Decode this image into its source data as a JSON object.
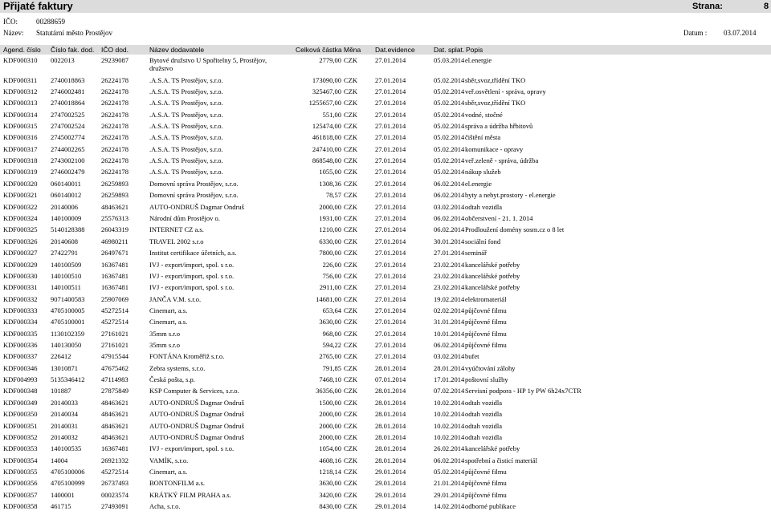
{
  "report": {
    "title": "Přijaté faktury",
    "page_label": "Strana:",
    "page_value": "8",
    "ico_label": "IČO:",
    "ico_value": "00288659",
    "name_label": "Název:",
    "name_value": "Statutární město Prostějov",
    "datum_label": "Datum :",
    "datum_value": "03.07.2014"
  },
  "columns": [
    "Agend. číslo",
    "Číslo fak. dod.",
    "IČO dod.",
    "Název dodavatele",
    "Celková částka",
    "Měna",
    "Dat.evidence",
    "Dat. splat.",
    "Popis"
  ],
  "rows": [
    {
      "a": "KDF000310",
      "b": "0022013",
      "c": "29239087",
      "d": "Bytové družstvo U Spořitelny 5, Prostějov,",
      "d2": "družstvo",
      "e": "2779,00",
      "f": "CZK",
      "g": "27.01.2014",
      "h": "05.03.2014",
      "i": "el.energie"
    },
    {
      "a": "KDF000311",
      "b": "2740018863",
      "c": "26224178",
      "d": ".A.S.A. TS Prostějov, s.r.o.",
      "e": "173090,00",
      "f": "CZK",
      "g": "27.01.2014",
      "h": "05.02.2014",
      "i": "sběr,svoz,třídění TKO"
    },
    {
      "a": "KDF000312",
      "b": "2746002481",
      "c": "26224178",
      "d": ".A.S.A. TS Prostějov, s.r.o.",
      "e": "325467,00",
      "f": "CZK",
      "g": "27.01.2014",
      "h": "05.02.2014",
      "i": "veř.osvětlení - správa, opravy"
    },
    {
      "a": "KDF000313",
      "b": "2740018864",
      "c": "26224178",
      "d": ".A.S.A. TS Prostějov, s.r.o.",
      "e": "1255657,00",
      "f": "CZK",
      "g": "27.01.2014",
      "h": "05.02.2014",
      "i": "sběr,svoz,třídění TKO"
    },
    {
      "a": "KDF000314",
      "b": "2747002525",
      "c": "26224178",
      "d": ".A.S.A. TS Prostějov, s.r.o.",
      "e": "551,00",
      "f": "CZK",
      "g": "27.01.2014",
      "h": "05.02.2014",
      "i": "vodné, stočné"
    },
    {
      "a": "KDF000315",
      "b": "2747002524",
      "c": "26224178",
      "d": ".A.S.A. TS Prostějov, s.r.o.",
      "e": "125474,00",
      "f": "CZK",
      "g": "27.01.2014",
      "h": "05.02.2014",
      "i": "správa a údržba hřbitovů"
    },
    {
      "a": "KDF000316",
      "b": "2745002774",
      "c": "26224178",
      "d": ".A.S.A. TS Prostějov, s.r.o.",
      "e": "461818,00",
      "f": "CZK",
      "g": "27.01.2014",
      "h": "05.02.2014",
      "i": "čištění města"
    },
    {
      "a": "KDF000317",
      "b": "2744002265",
      "c": "26224178",
      "d": ".A.S.A. TS Prostějov, s.r.o.",
      "e": "247410,00",
      "f": "CZK",
      "g": "27.01.2014",
      "h": "05.02.2014",
      "i": "komunikace - opravy"
    },
    {
      "a": "KDF000318",
      "b": "2743002100",
      "c": "26224178",
      "d": ".A.S.A. TS Prostějov, s.r.o.",
      "e": "868548,00",
      "f": "CZK",
      "g": "27.01.2014",
      "h": "05.02.2014",
      "i": "veř.zeleně - správa, údržba"
    },
    {
      "a": "KDF000319",
      "b": "2746002479",
      "c": "26224178",
      "d": ".A.S.A. TS Prostějov, s.r.o.",
      "e": "1055,00",
      "f": "CZK",
      "g": "27.01.2014",
      "h": "05.02.2014",
      "i": "nákup služeb"
    },
    {
      "a": "KDF000320",
      "b": "060140011",
      "c": "26259893",
      "d": "Domovní správa Prostějov, s.r.o.",
      "e": "1308,36",
      "f": "CZK",
      "g": "27.01.2014",
      "h": "06.02.2014",
      "i": "el.energie"
    },
    {
      "a": "KDF000321",
      "b": "060140012",
      "c": "26259893",
      "d": "Domovní správa Prostějov, s.r.o.",
      "e": "78,57",
      "f": "CZK",
      "g": "27.01.2014",
      "h": "06.02.2014",
      "i": "byty a nebyt.prostory - el.energie"
    },
    {
      "a": "KDF000322",
      "b": "20140006",
      "c": "48463621",
      "d": "AUTO-ONDRUŠ Dagmar Ondruš",
      "e": "2000,00",
      "f": "CZK",
      "g": "27.01.2014",
      "h": "03.02.2014",
      "i": "odtah vozidla"
    },
    {
      "a": "KDF000324",
      "b": "140100009",
      "c": "25576313",
      "d": "Národní dům Prostějov o.",
      "e": "1931,00",
      "f": "CZK",
      "g": "27.01.2014",
      "h": "06.02.2014",
      "i": "občerstvení - 21. 1. 2014"
    },
    {
      "a": "KDF000325",
      "b": "5140128388",
      "c": "26043319",
      "d": "INTERNET CZ a.s.",
      "e": "1210,00",
      "f": "CZK",
      "g": "27.01.2014",
      "h": "06.02.2014",
      "i": "Prodloužení domény sosm.cz o 8 let"
    },
    {
      "a": "KDF000326",
      "b": "20140608",
      "c": "46980211",
      "d": "TRAVEL 2002 s.r.o",
      "e": "6330,00",
      "f": "CZK",
      "g": "27.01.2014",
      "h": "30.01.2014",
      "i": "sociální fond"
    },
    {
      "a": "KDF000327",
      "b": "27422791",
      "c": "26497671",
      "d": "Institut certifikace účetních, a.s.",
      "e": "7800,00",
      "f": "CZK",
      "g": "27.01.2014",
      "h": "27.01.2014",
      "i": "seminář"
    },
    {
      "a": "KDF000329",
      "b": "140100509",
      "c": "16367481",
      "d": "IVJ - export/import, spol. s r.o.",
      "e": "226,00",
      "f": "CZK",
      "g": "27.01.2014",
      "h": "23.02.2014",
      "i": "kancelářské potřeby"
    },
    {
      "a": "KDF000330",
      "b": "140100510",
      "c": "16367481",
      "d": "IVJ - export/import, spol. s r.o.",
      "e": "756,00",
      "f": "CZK",
      "g": "27.01.2014",
      "h": "23.02.2014",
      "i": "kancelářské potřeby"
    },
    {
      "a": "KDF000331",
      "b": "140100511",
      "c": "16367481",
      "d": "IVJ - export/import, spol. s r.o.",
      "e": "2911,00",
      "f": "CZK",
      "g": "27.01.2014",
      "h": "23.02.2014",
      "i": "kancelářské potřeby"
    },
    {
      "a": "KDF000332",
      "b": "9071400583",
      "c": "25907069",
      "d": "JANČA V.M. s.r.o.",
      "e": "14681,00",
      "f": "CZK",
      "g": "27.01.2014",
      "h": "19.02.2014",
      "i": "elektromateriál"
    },
    {
      "a": "KDF000333",
      "b": "4705100005",
      "c": "45272514",
      "d": "Cinemart, a.s.",
      "e": "653,64",
      "f": "CZK",
      "g": "27.01.2014",
      "h": "02.02.2014",
      "i": "půjčovné filmu"
    },
    {
      "a": "KDF000334",
      "b": "4705100001",
      "c": "45272514",
      "d": "Cinemart, a.s.",
      "e": "3630,00",
      "f": "CZK",
      "g": "27.01.2014",
      "h": "31.01.2014",
      "i": "půjčovné filmu"
    },
    {
      "a": "KDF000335",
      "b": "1130102359",
      "c": "27161021",
      "d": "35mm s.r.o",
      "e": "968,00",
      "f": "CZK",
      "g": "27.01.2014",
      "h": "10.01.2014",
      "i": "půjčovné filmu"
    },
    {
      "a": "KDF000336",
      "b": "140130050",
      "c": "27161021",
      "d": "35mm s.r.o",
      "e": "594,22",
      "f": "CZK",
      "g": "27.01.2014",
      "h": "06.02.2014",
      "i": "půjčovné filmu"
    },
    {
      "a": "KDF000337",
      "b": "226412",
      "c": "47915544",
      "d": "FONTÁNA Kroměříž s.r.o.",
      "e": "2765,00",
      "f": "CZK",
      "g": "27.01.2014",
      "h": "03.02.2014",
      "i": "bufet"
    },
    {
      "a": "KDF000346",
      "b": "13010871",
      "c": "47675462",
      "d": "Zebra systems, s.r.o.",
      "e": "791,85",
      "f": "CZK",
      "g": "28.01.2014",
      "h": "28.01.2014",
      "i": "vyúčtování zálohy"
    },
    {
      "a": "KDF004993",
      "b": "5135346412",
      "c": "47114983",
      "d": "Česká pošta, s.p.",
      "e": "7468,10",
      "f": "CZK",
      "g": "07.01.2014",
      "h": "17.01.2014",
      "i": "poštovní služby"
    },
    {
      "a": "KDF000348",
      "b": "101887",
      "c": "27875849",
      "d": "KSP Computer & Services, s.r.o.",
      "e": "36356,00",
      "f": "CZK",
      "g": "28.01.2014",
      "h": "07.02.2014",
      "i": "Servisní podpora - HP 1y PW 6h24x7CTR"
    },
    {
      "a": "KDF000349",
      "b": "20140033",
      "c": "48463621",
      "d": "AUTO-ONDRUŠ Dagmar Ondruš",
      "e": "1500,00",
      "f": "CZK",
      "g": "28.01.2014",
      "h": "10.02.2014",
      "i": "odtah vozidla"
    },
    {
      "a": "KDF000350",
      "b": "20140034",
      "c": "48463621",
      "d": "AUTO-ONDRUŠ Dagmar Ondruš",
      "e": "2000,00",
      "f": "CZK",
      "g": "28.01.2014",
      "h": "10.02.2014",
      "i": "odtah vozidla"
    },
    {
      "a": "KDF000351",
      "b": "20140031",
      "c": "48463621",
      "d": "AUTO-ONDRUŠ Dagmar Ondruš",
      "e": "2000,00",
      "f": "CZK",
      "g": "28.01.2014",
      "h": "10.02.2014",
      "i": "odtah vozidla"
    },
    {
      "a": "KDF000352",
      "b": "20140032",
      "c": "48463621",
      "d": "AUTO-ONDRUŠ Dagmar Ondruš",
      "e": "2000,00",
      "f": "CZK",
      "g": "28.01.2014",
      "h": "10.02.2014",
      "i": "odtah vozidla"
    },
    {
      "a": "KDF000353",
      "b": "140100535",
      "c": "16367481",
      "d": "IVJ - export/import, spol. s r.o.",
      "e": "1054,00",
      "f": "CZK",
      "g": "28.01.2014",
      "h": "26.02.2014",
      "i": "kancelářské potřeby"
    },
    {
      "a": "KDF000354",
      "b": "14004",
      "c": "26921332",
      "d": "VAMÍK, s.r.o.",
      "e": "4608,16",
      "f": "CZK",
      "g": "28.01.2014",
      "h": "06.02.2014",
      "i": "spotřební a čisticí materiál"
    },
    {
      "a": "KDF000355",
      "b": "4705100006",
      "c": "45272514",
      "d": "Cinemart, a.s.",
      "e": "1218,14",
      "f": "CZK",
      "g": "29.01.2014",
      "h": "05.02.2014",
      "i": "půjčovné filmu"
    },
    {
      "a": "KDF000356",
      "b": "4705100999",
      "c": "26737493",
      "d": "BONTONFILM a.s.",
      "e": "3630,00",
      "f": "CZK",
      "g": "29.01.2014",
      "h": "21.01.2014",
      "i": "půjčovné filmu"
    },
    {
      "a": "KDF000357",
      "b": "1400001",
      "c": "00023574",
      "d": "KRÁTKÝ FILM PRAHA a.s.",
      "e": "3420,00",
      "f": "CZK",
      "g": "29.01.2014",
      "h": "29.01.2014",
      "i": "půjčovné filmu"
    },
    {
      "a": "KDF000358",
      "b": "461715",
      "c": "27493091",
      "d": "Acha, s.r.o.",
      "e": "8430,00",
      "f": "CZK",
      "g": "29.01.2014",
      "h": "14.02.2014",
      "i": "odborné publikace"
    }
  ]
}
